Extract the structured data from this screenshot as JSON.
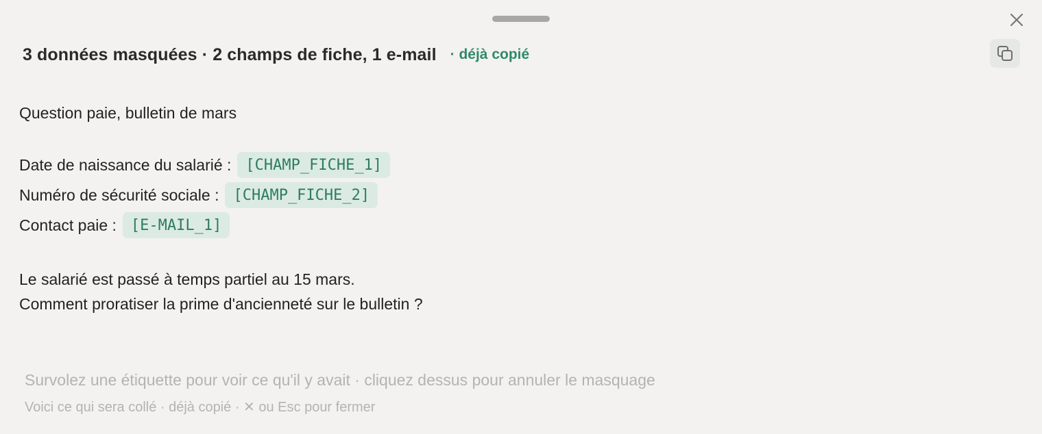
{
  "header": {
    "title": "3 données masquées · 2 champs de fiche, 1 e-mail",
    "status": "· déjà copié"
  },
  "icons": {
    "close": "close-icon",
    "copy": "copy-icon"
  },
  "colors": {
    "accent": "#2f8a66",
    "chip_bg": "#dbebe4",
    "chip_text": "#2e7c5c",
    "background": "#f3f2f1"
  },
  "message": {
    "subject": "Question paie, bulletin de mars",
    "fields": [
      {
        "label": "Date de naissance du salarié :",
        "tag": "[CHAMP_FICHE_1]"
      },
      {
        "label": "Numéro de sécurité sociale :",
        "tag": "[CHAMP_FICHE_2]"
      },
      {
        "label": "Contact paie :",
        "tag": "[E-MAIL_1]"
      }
    ],
    "body_lines": [
      "Le salarié est passé à temps partiel au 15 mars.",
      "Comment proratiser la prime d'ancienneté sur le bulletin ?"
    ]
  },
  "footer": {
    "hint": "Survolez une étiquette pour voir ce qu'il y avait · cliquez dessus pour annuler le masquage",
    "info": "Voici ce qui sera collé · déjà copié · ✕ ou Esc pour fermer"
  }
}
